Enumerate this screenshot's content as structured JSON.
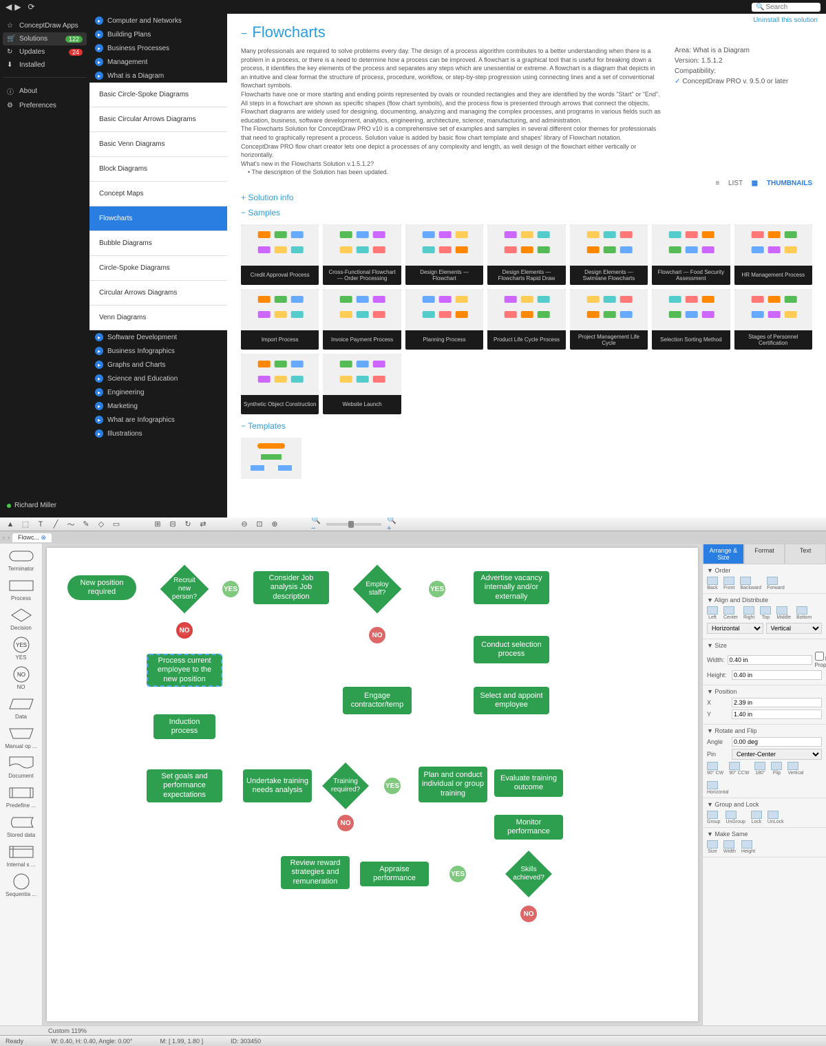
{
  "search_placeholder": "Search",
  "uninstall": "Uninstall this solution",
  "left_nav": [
    {
      "label": "ConceptDraw Apps",
      "icon": "☆"
    },
    {
      "label": "Solutions",
      "icon": "🛒",
      "active": true,
      "badge": "122",
      "badge_color": "green"
    },
    {
      "label": "Updates",
      "icon": "↻",
      "badge": "24",
      "badge_color": "red"
    },
    {
      "label": "Installed",
      "icon": "⬇"
    }
  ],
  "left_nav2": [
    {
      "label": "About",
      "icon": "ⓘ"
    },
    {
      "label": "Preferences",
      "icon": "⚙"
    }
  ],
  "user": "Richard Miller",
  "categories_top": [
    "Computer and Networks",
    "Building Plans",
    "Business Processes",
    "Management",
    "What is a Diagram"
  ],
  "subcategories": [
    {
      "label": "Basic Circle-Spoke Diagrams"
    },
    {
      "label": "Basic Circular Arrows Diagrams"
    },
    {
      "label": "Basic Venn Diagrams"
    },
    {
      "label": "Block Diagrams"
    },
    {
      "label": "Concept Maps"
    },
    {
      "label": "Flowcharts",
      "active": true
    },
    {
      "label": "Bubble Diagrams"
    },
    {
      "label": "Circle-Spoke Diagrams"
    },
    {
      "label": "Circular Arrows Diagrams"
    },
    {
      "label": "Venn Diagrams"
    }
  ],
  "categories_bottom": [
    "Software Development",
    "Business Infographics",
    "Graphs and Charts",
    "Science and Education",
    "Engineering",
    "Marketing",
    "What are Infographics",
    "Illustrations"
  ],
  "page_title": "Flowcharts",
  "description1": "Many professionals are required to solve problems every day. The design of a process algorithm contributes to a better understanding when there is a problem in a process, or there is a need to determine how a process can be improved. A flowchart is a graphical tool that is useful for breaking down a process, it identifies the key elements of the process and separates any steps which are unessential or extreme. A flowchart is a diagram that depicts in an intuitive and clear format the structure of process, procedure, workflow, or step-by-step progression using connecting lines and a set of conventional flowchart symbols.",
  "description2": "Flowcharts have one or more starting and ending points represented by ovals or rounded rectangles and they are identified by the words \"Start\" or \"End\". All steps in a flowchart are shown as specific shapes (flow chart symbols), and the process flow is presented through arrows that connect the objects.",
  "description3": "Flowchart diagrams are widely used for designing, documenting, analyzing and managing the complex processes, and programs in various fields such as education, business, software development, analytics, engineering, architecture, science, manufacturing, and administration.",
  "description4": "The Flowcharts Solution for ConceptDraw PRO v10 is a comprehensive set of examples and samples in several different color themes for professionals that need to graphically represent a process. Solution value is added by basic flow chart template and shapes' library of Flowchart notation. ConceptDraw PRO flow chart creator lets one depict a processes of any complexity and length, as well design of the flowchart either vertically or horizontally.",
  "whatsnew_title": "What's new in the Flowcharts Solution v.1.5.1.2?",
  "whatsnew_item": "• The description of the Solution has been updated.",
  "meta": {
    "area_label": "Area:",
    "area": "What is a Diagram",
    "version_label": "Version:",
    "version": "1.5.1.2",
    "compat_label": "Compatibility:",
    "compat": "ConceptDraw PRO v. 9.5.0 or later"
  },
  "solution_info": "Solution info",
  "samples_label": "Samples",
  "list_label": "LIST",
  "thumbs_label": "THUMBNAILS",
  "samples": [
    "Credit Approval Process",
    "Cross-Functional Flowchart — Order Processing",
    "Design Elements — Flowchart",
    "Design Elements — Flowcharts Rapid Draw",
    "Design Elements — Swimlane Flowcharts",
    "Flowchart — Food Security Assessment",
    "HR Management Process",
    "Import Process",
    "Invoice Payment Process",
    "Planning Process",
    "Product Life Cycle Process",
    "Project Management Life Cycle",
    "Selection Sorting Method",
    "Stages of Personnel Certification",
    "Synthetic Object Construction",
    "Website Launch"
  ],
  "templates_label": "Templates",
  "editor_tab": "Flowc...",
  "shapes": [
    "Terminator",
    "Process",
    "Decision",
    "YES",
    "NO",
    "Data",
    "Manual op ...",
    "Document",
    "Predefine ...",
    "Stored data",
    "Internal s ...",
    "Sequentia ..."
  ],
  "props_tabs": [
    "Arrange & Size",
    "Format",
    "Text"
  ],
  "props": {
    "order_title": "Order",
    "order": [
      "Back",
      "Front",
      "Backward",
      "Forward"
    ],
    "align_title": "Align and Distribute",
    "align1": [
      "Left",
      "Center",
      "Right",
      "Top",
      "Middle",
      "Bottom"
    ],
    "align_horiz": "Horizontal",
    "align_vert": "Vertical",
    "size_title": "Size",
    "width_label": "Width:",
    "width_val": "0.40 in",
    "height_label": "Height:",
    "height_val": "0.40 in",
    "lockprop": "Lock Proportions",
    "pos_title": "Position",
    "x_label": "X",
    "x_val": "2.39 in",
    "y_label": "Y",
    "y_val": "1.40 in",
    "rotate_title": "Rotate and Flip",
    "angle_label": "Angle",
    "angle_val": "0.00 deg",
    "pin_label": "Pin",
    "pin_val": "Center-Center",
    "rotate_icons": [
      "90° CW",
      "90° CCW",
      "180°",
      "Flip",
      "Vertical",
      "Horizontal"
    ],
    "group_title": "Group and Lock",
    "group_icons": [
      "Group",
      "UnGroup",
      "Lock",
      "UnLock"
    ],
    "make_title": "Make Same",
    "make_icons": [
      "Size",
      "Width",
      "Height"
    ]
  },
  "zoom": "Custom 119%",
  "status": {
    "ready": "Ready",
    "wh": "W: 0.40, H: 0.40, Angle: 0.00°",
    "m": "M: [ 1.99, 1.80 ]",
    "id": "ID: 303450"
  },
  "flowchart": {
    "n1": "New position required",
    "n2": "Recruit new person?",
    "n3": "Consider Job analysis Job description",
    "n4": "Employ staff?",
    "n5": "Advertise vacancy internally and/or externally",
    "n6": "Process current employee to the new position",
    "n7": "Conduct selection process",
    "n8": "Engage contractor/temp",
    "n9": "Select and appoint employee",
    "n10": "Induction process",
    "n11": "Set goals and performance expectations",
    "n12": "Undertake training needs analysis",
    "n13": "Training required?",
    "n14": "Plan and conduct individual or group training",
    "n15": "Evaluate training outcome",
    "n16": "Monitor performance",
    "n17": "Skills achieved?",
    "n18": "Appraise performance",
    "n19": "Review reward strategies and remuneration",
    "yes": "YES",
    "no": "NO"
  }
}
